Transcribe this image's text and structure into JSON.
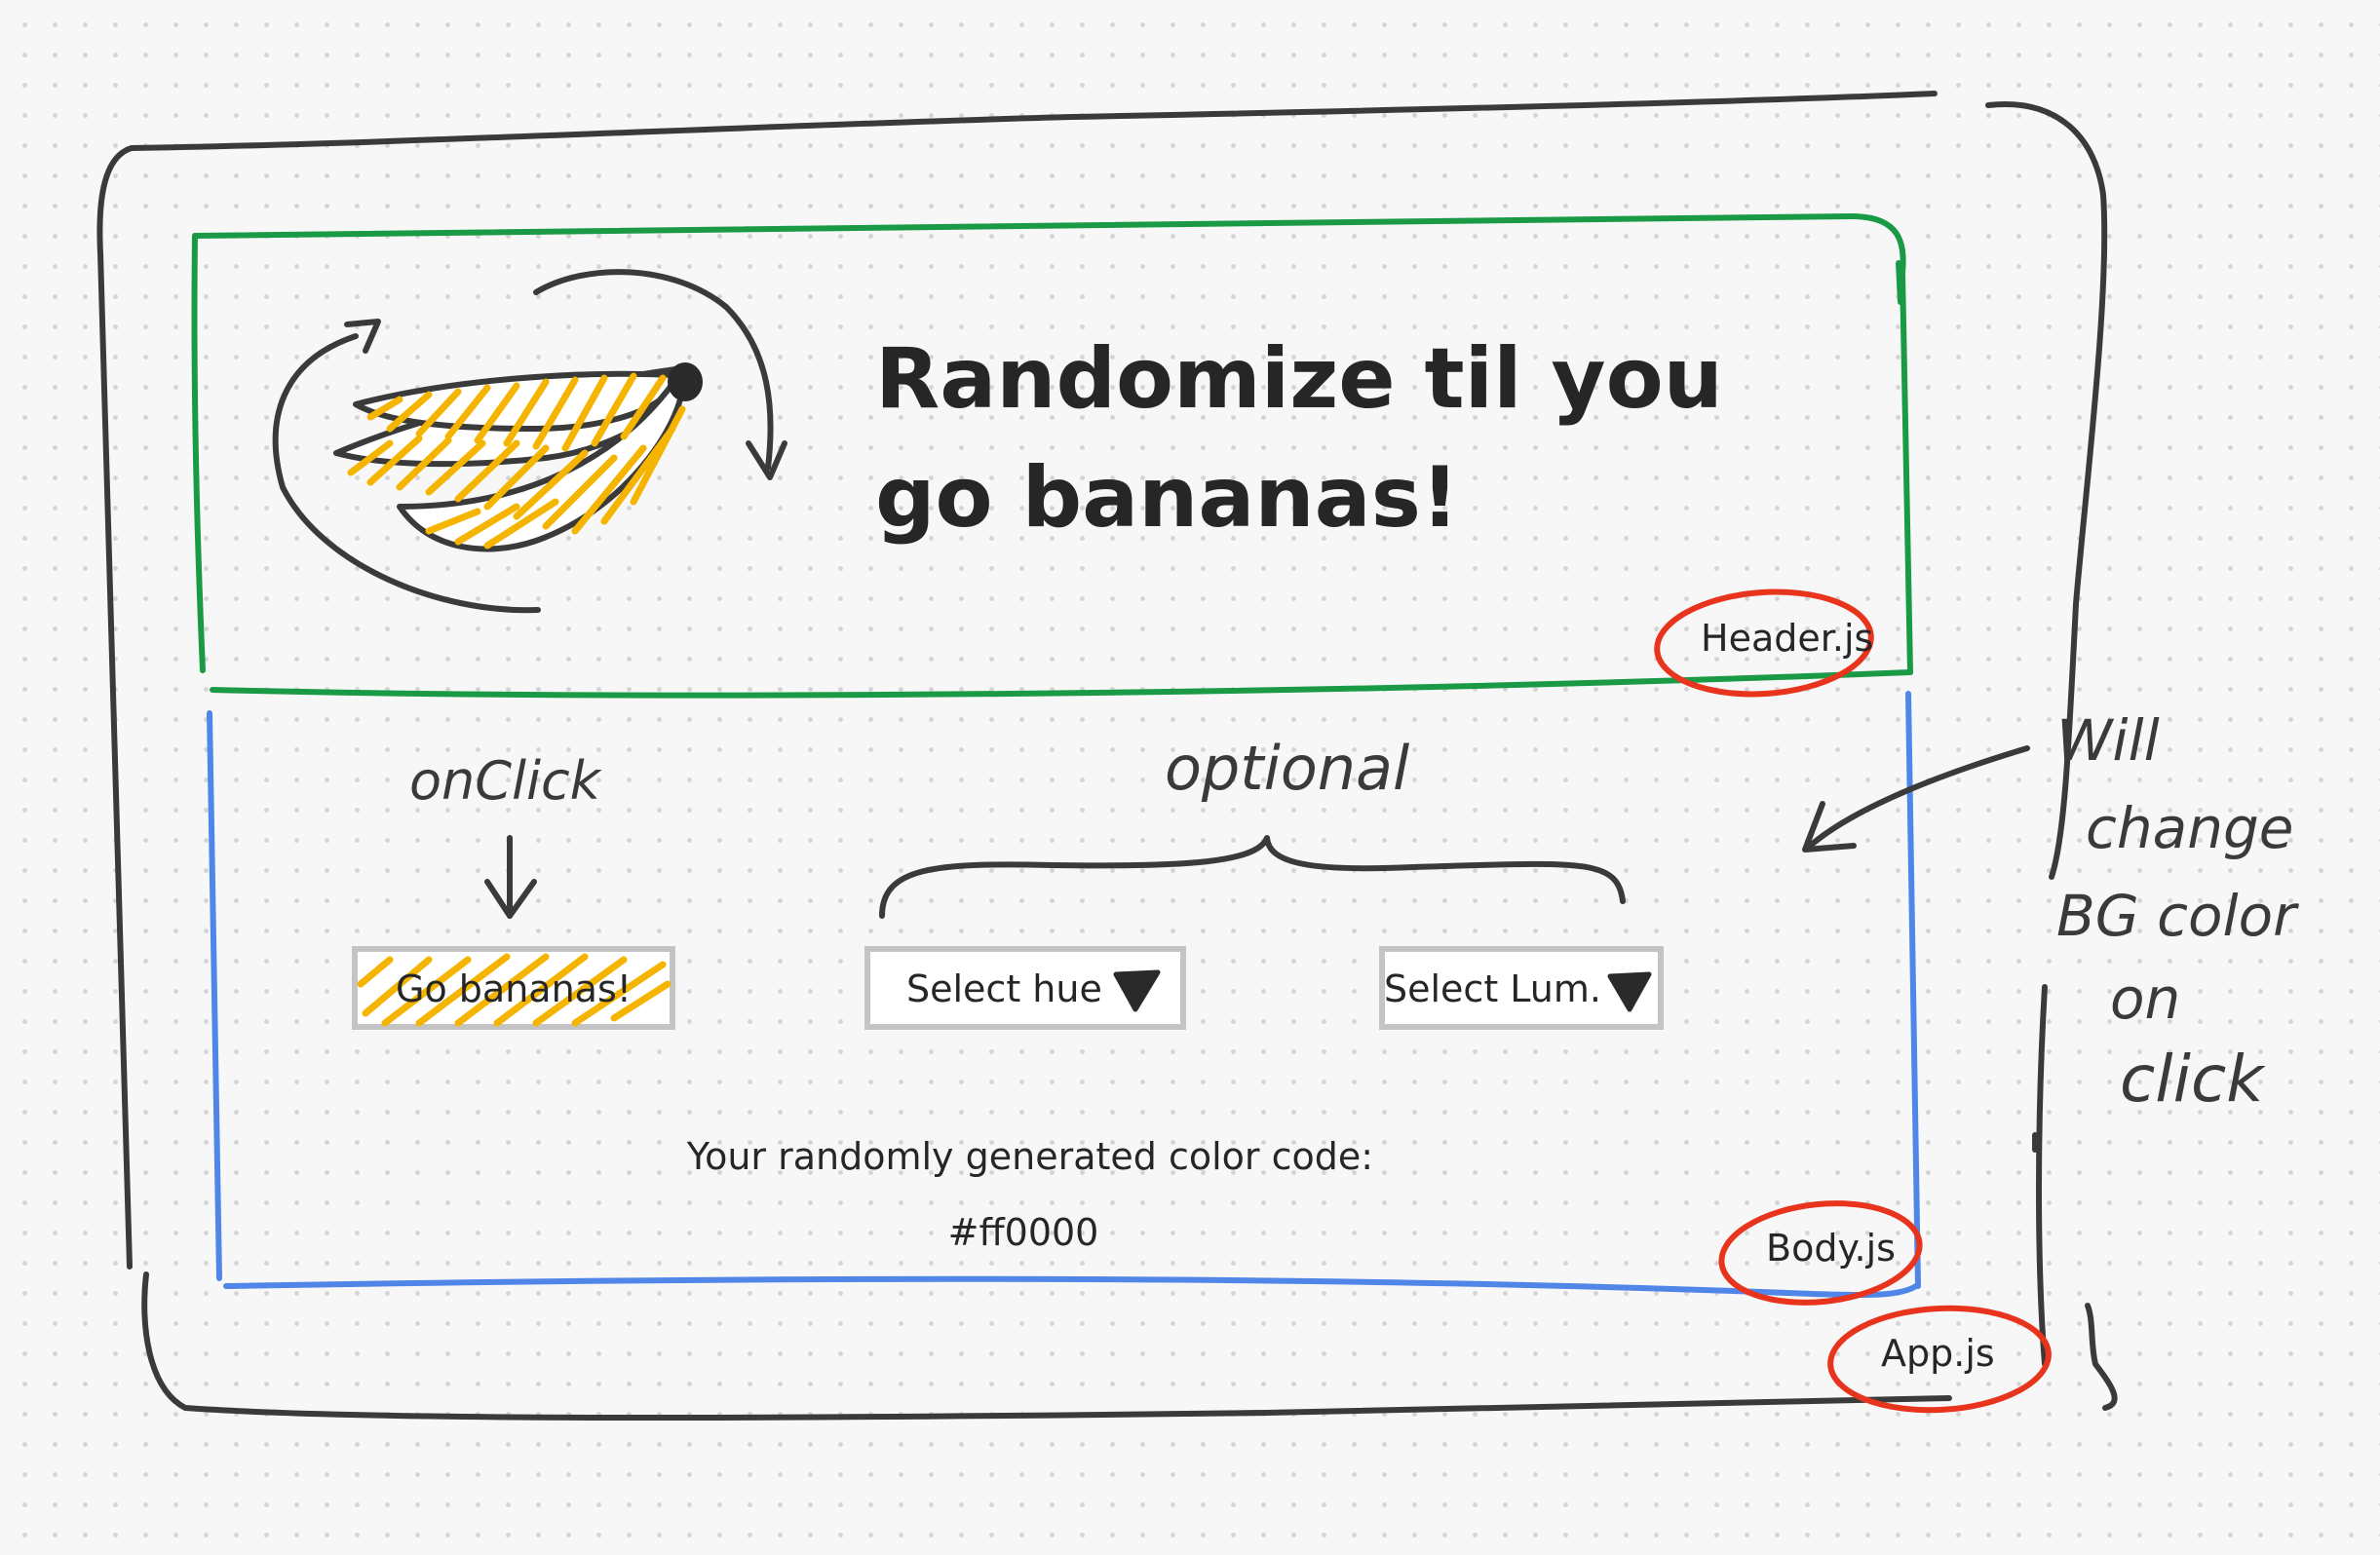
{
  "header": {
    "title_line1": "Randomize til you",
    "title_line2": "go bananas!",
    "component_label": "Header.js"
  },
  "body": {
    "onclick_note": "onClick",
    "optional_note": "optional",
    "go_button_label": "Go bananas!",
    "hue_select_label": "Select hue",
    "lum_select_label": "Select Lum.",
    "color_code_caption": "Your randomly generated color code:",
    "color_code_value": "#ff0000",
    "component_label": "Body.js"
  },
  "app": {
    "component_label": "App.js"
  },
  "side_note": {
    "line1": "Will",
    "line2": "change",
    "line3": "BG color",
    "line4": "on",
    "line5": "click"
  },
  "colors": {
    "ink": "#3a3a3a",
    "header_border": "#1a9a45",
    "body_border": "#4f86e8",
    "highlight_circle": "#e8341c",
    "banana_yellow": "#f4b400",
    "button_border": "#c4c4c4"
  },
  "icons": {
    "banana": "banana-icon",
    "rotate_arrows": "rotate-arrows-icon",
    "dropdown": "triangle-down-icon"
  }
}
